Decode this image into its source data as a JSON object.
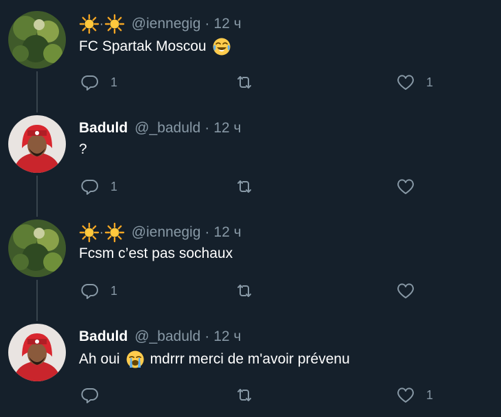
{
  "colors": {
    "background": "#15202b",
    "text": "#ffffff",
    "muted": "#8899a6",
    "thread_line": "#38444d"
  },
  "tweets": [
    {
      "name": "",
      "name_icons": [
        "sun-icon",
        "sun-icon"
      ],
      "handle": "@iennegig",
      "dot": "·",
      "time": "12 ч",
      "text_before": "FC Spartak Moscou",
      "emoji": "joy-emoji",
      "text_after": "",
      "reply_count": "1",
      "retweet_count": "",
      "like_count": "1"
    },
    {
      "name": "Baduld",
      "name_icons": [],
      "handle": "@_baduld",
      "dot": "·",
      "time": "12 ч",
      "text_before": "?",
      "emoji": "",
      "text_after": "",
      "reply_count": "1",
      "retweet_count": "",
      "like_count": ""
    },
    {
      "name": "",
      "name_icons": [
        "sun-icon",
        "sun-icon"
      ],
      "handle": "@iennegig",
      "dot": "·",
      "time": "12 ч",
      "text_before": "Fcsm c’est pas sochaux",
      "emoji": "",
      "text_after": "",
      "reply_count": "1",
      "retweet_count": "",
      "like_count": ""
    },
    {
      "name": "Baduld",
      "name_icons": [],
      "handle": "@_baduld",
      "dot": "·",
      "time": "12 ч",
      "text_before": "Ah oui",
      "emoji": "sob-emoji",
      "text_after": "mdrrr merci de m'avoir prévenu",
      "reply_count": "",
      "retweet_count": "",
      "like_count": "1"
    }
  ]
}
